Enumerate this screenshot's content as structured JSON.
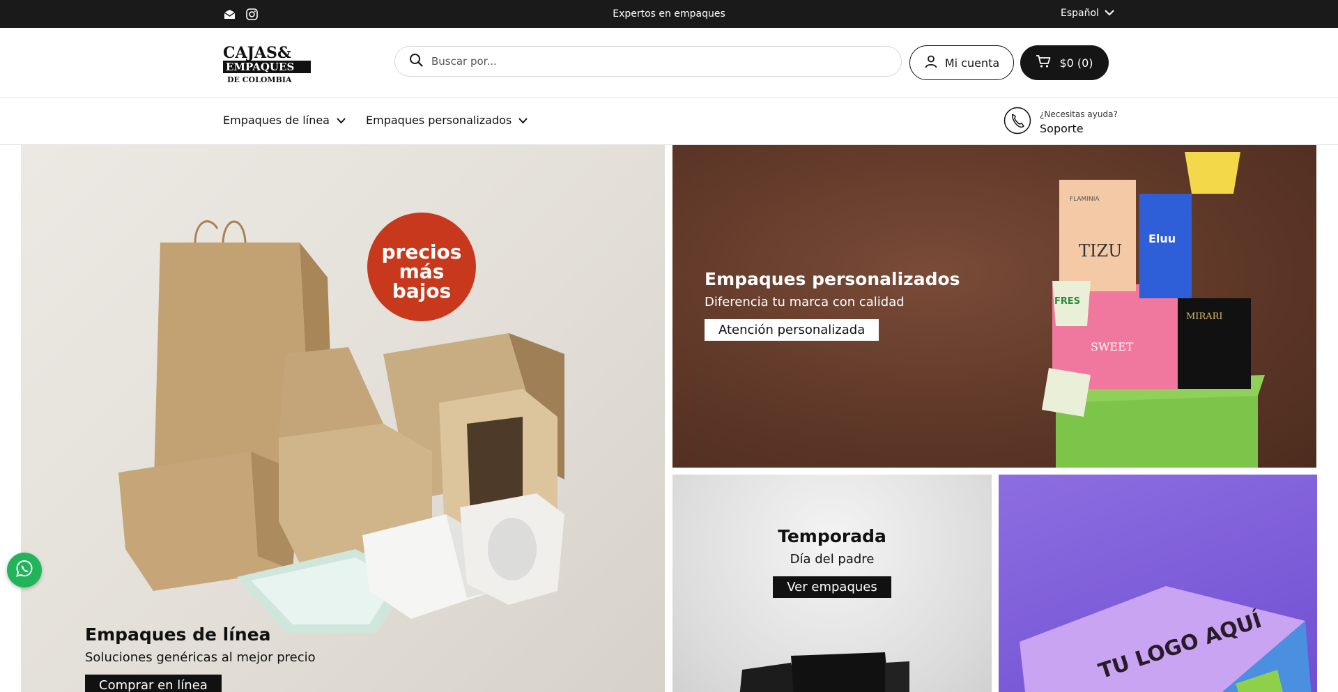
{
  "topbar": {
    "announcement": "Expertos en empaques",
    "language": "Español",
    "icons": [
      "email-icon",
      "instagram-icon"
    ]
  },
  "header": {
    "logo": {
      "line1": "CAJAS&",
      "line2": "EMPAQUES",
      "line3": "DE COLOMBIA"
    },
    "search": {
      "placeholder": "Buscar por..."
    },
    "account_label": "Mi cuenta",
    "cart_label": "$0 (0)"
  },
  "nav": {
    "items": [
      {
        "label": "Empaques de línea"
      },
      {
        "label": "Empaques personalizados"
      }
    ],
    "support": {
      "small": "¿Necesitas ayuda?",
      "big": "Soporte"
    }
  },
  "banners": {
    "main": {
      "title": "Empaques de línea",
      "subtitle": "Soluciones genéricas al mejor precio",
      "button": "Comprar en línea",
      "badge_line1": "precios",
      "badge_line2": "más bajos"
    },
    "custom": {
      "title": "Empaques personalizados",
      "subtitle": "Diferencia tu marca con calidad",
      "button": "Atención personalizada",
      "product_words": [
        "TIZU",
        "FLAMINIA",
        "MIRARI",
        "SWEET",
        "FRES",
        "Eluu"
      ]
    },
    "season": {
      "title": "Temporada",
      "subtitle": "Día del padre",
      "button": "Ver empaques"
    },
    "logo": {
      "box_text": "TU LOGO AQUÍ"
    }
  },
  "colors": {
    "topbar_bg": "#1a1a1a",
    "cart_bg": "#151515",
    "badge_red": "#c8381c",
    "whatsapp_green": "#21b45a"
  }
}
